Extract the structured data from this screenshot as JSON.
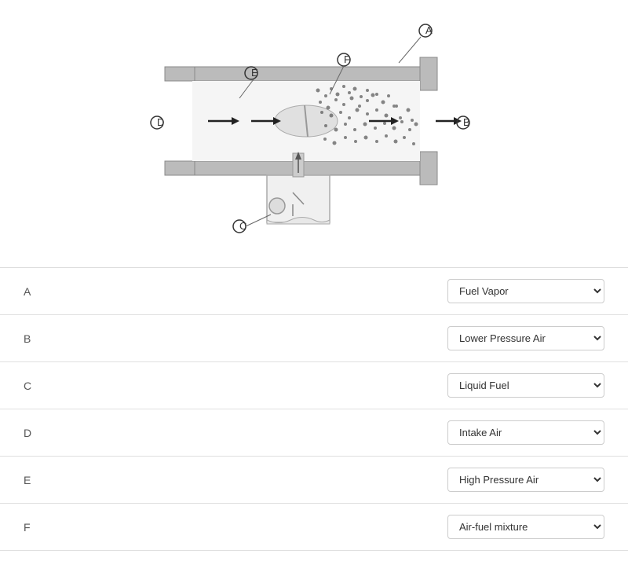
{
  "diagram": {
    "alt": "Carburetor diagram with labeled parts A through F"
  },
  "rows": [
    {
      "id": "A",
      "label": "A",
      "selected": "Fuel Vapor",
      "options": [
        "Fuel Vapor",
        "Lower Pressure Air",
        "Liquid Fuel",
        "Intake Air",
        "High Pressure Air",
        "Air-fuel mixture"
      ]
    },
    {
      "id": "B",
      "label": "B",
      "selected": "Lower Pressure Air",
      "options": [
        "Fuel Vapor",
        "Lower Pressure Air",
        "Liquid Fuel",
        "Intake Air",
        "High Pressure Air",
        "Air-fuel mixture"
      ]
    },
    {
      "id": "C",
      "label": "C",
      "selected": "Liquid Fuel",
      "options": [
        "Fuel Vapor",
        "Lower Pressure Air",
        "Liquid Fuel",
        "Intake Air",
        "High Pressure Air",
        "Air-fuel mixture"
      ]
    },
    {
      "id": "D",
      "label": "D",
      "selected": "Intake Air",
      "options": [
        "Fuel Vapor",
        "Lower Pressure Air",
        "Liquid Fuel",
        "Intake Air",
        "High Pressure Air",
        "Air-fuel mixture"
      ]
    },
    {
      "id": "E",
      "label": "E",
      "selected": "High Pressure Air",
      "options": [
        "Fuel Vapor",
        "Lower Pressure Air",
        "Liquid Fuel",
        "Intake Air",
        "High Pressure Air",
        "Air-fuel mixture"
      ]
    },
    {
      "id": "F",
      "label": "F",
      "selected": "Air-fuel mixture",
      "options": [
        "Fuel Vapor",
        "Lower Pressure Air",
        "Liquid Fuel",
        "Intake Air",
        "High Pressure Air",
        "Air-fuel mixture"
      ]
    }
  ]
}
